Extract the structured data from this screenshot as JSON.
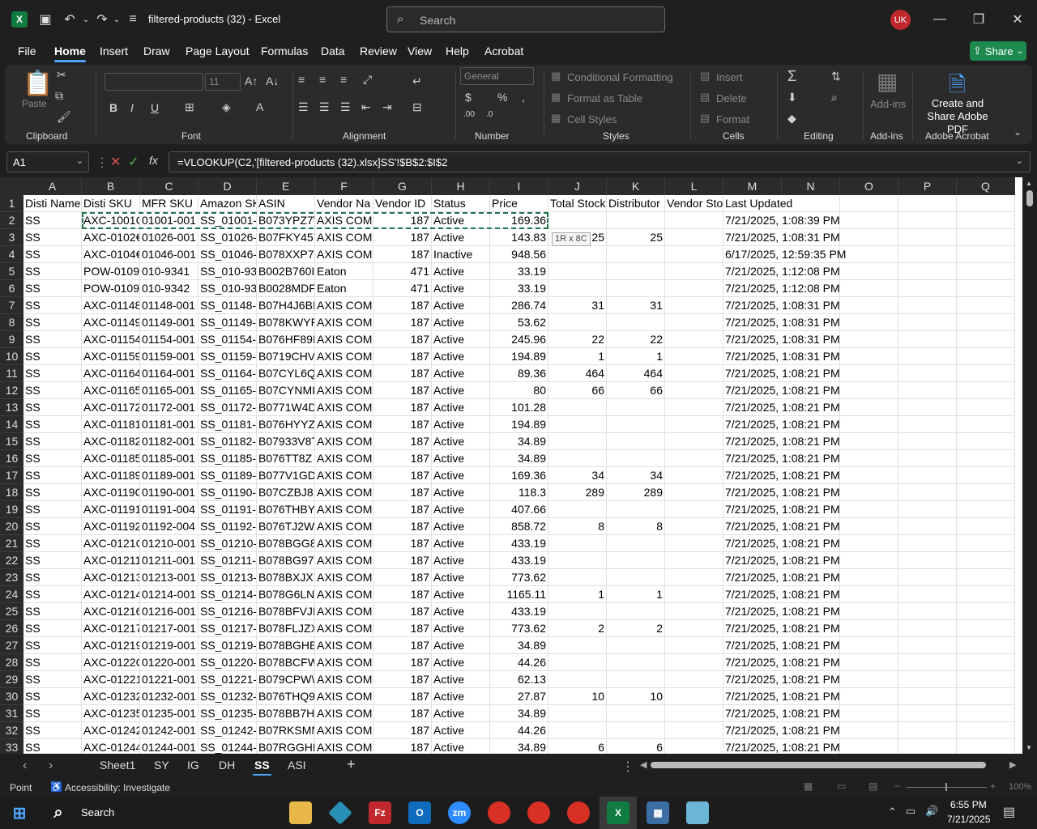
{
  "window": {
    "title": "filtered-products (32)  -  Excel",
    "search_placeholder": "Search",
    "user_initials": "UK",
    "share_label": "Share"
  },
  "ribbon_tabs": [
    "File",
    "Home",
    "Insert",
    "Draw",
    "Page Layout",
    "Formulas",
    "Data",
    "Review",
    "View",
    "Help",
    "Acrobat"
  ],
  "ribbon": {
    "clipboard": {
      "label": "Clipboard",
      "paste": "Paste"
    },
    "font": {
      "label": "Font",
      "size": "11",
      "bold": "B",
      "italic": "I",
      "underline": "U"
    },
    "alignment": {
      "label": "Alignment"
    },
    "number": {
      "label": "Number",
      "format": "General"
    },
    "styles": {
      "label": "Styles",
      "conditional": "Conditional Formatting",
      "format_table": "Format as Table",
      "cell_styles": "Cell Styles"
    },
    "cells": {
      "label": "Cells",
      "insert": "Insert",
      "delete": "Delete",
      "format": "Format"
    },
    "editing": {
      "label": "Editing"
    },
    "addins": {
      "label": "Add-ins",
      "button": "Add-ins"
    },
    "acrobat": {
      "label": "Adobe Acrobat",
      "button": "Create and Share Adobe PDF"
    }
  },
  "formula_bar": {
    "name_box": "A1",
    "formula": "=VLOOKUP(C2,'[filtered-products (32).xlsx]SS'!$B$2:$I$2"
  },
  "columns": [
    "A",
    "B",
    "C",
    "D",
    "E",
    "F",
    "G",
    "H",
    "I",
    "J",
    "K",
    "L",
    "M",
    "N",
    "O",
    "P",
    "Q"
  ],
  "headers": [
    "Disti Name",
    "Disti SKU",
    "MFR SKU",
    "Amazon SK",
    "ASIN",
    "Vendor Na",
    "Vendor ID",
    "Status",
    "Price",
    "Total Stock",
    "Distributor",
    "Vendor Sto",
    "Last Updated"
  ],
  "rows": [
    [
      "SS",
      "AXC-1001C",
      "01001-001",
      "SS_01001-(",
      "B073YPZ7\\",
      "AXIS COMI",
      "187",
      "Active",
      "169.36",
      "",
      "",
      "",
      "7/21/2025, 1:08:39 PM"
    ],
    [
      "SS",
      "AXC-0102€",
      "01026-001",
      "SS_01026-(",
      "B07FKY457",
      "AXIS COMI",
      "187",
      "Active",
      "143.83",
      "25",
      "25",
      "",
      "7/21/2025, 1:08:31 PM"
    ],
    [
      "SS",
      "AXC-0104€",
      "01046-001",
      "SS_01046-(",
      "B078XXP7I",
      "AXIS COMI",
      "187",
      "Inactive",
      "948.56",
      "",
      "",
      "",
      "6/17/2025, 12:59:35 PM"
    ],
    [
      "SS",
      "POW-0109",
      "010-9341",
      "SS_010-93",
      "B002B760I",
      "Eaton",
      "471",
      "Active",
      "33.19",
      "",
      "",
      "",
      "7/21/2025, 1:12:08 PM"
    ],
    [
      "SS",
      "POW-0109",
      "010-9342",
      "SS_010-93",
      "B0028MDF",
      "Eaton",
      "471",
      "Active",
      "33.19",
      "",
      "",
      "",
      "7/21/2025, 1:12:08 PM"
    ],
    [
      "SS",
      "AXC-01148",
      "01148-001",
      "SS_01148-(",
      "B07H4J6BI",
      "AXIS COMI",
      "187",
      "Active",
      "286.74",
      "31",
      "31",
      "",
      "7/21/2025, 1:08:31 PM"
    ],
    [
      "SS",
      "AXC-01149",
      "01149-001",
      "SS_01149-(",
      "B078KWYF",
      "AXIS COMI",
      "187",
      "Active",
      "53.62",
      "",
      "",
      "",
      "7/21/2025, 1:08:31 PM"
    ],
    [
      "SS",
      "AXC-01154",
      "01154-001",
      "SS_01154-(",
      "B076HF89I",
      "AXIS COMI",
      "187",
      "Active",
      "245.96",
      "22",
      "22",
      "",
      "7/21/2025, 1:08:31 PM"
    ],
    [
      "SS",
      "AXC-01159",
      "01159-001",
      "SS_01159-(",
      "B0719CHV",
      "AXIS COMI",
      "187",
      "Active",
      "194.89",
      "1",
      "1",
      "",
      "7/21/2025, 1:08:31 PM"
    ],
    [
      "SS",
      "AXC-01164",
      "01164-001",
      "SS_01164-(",
      "B07CYL6Q",
      "AXIS COMI",
      "187",
      "Active",
      "89.36",
      "464",
      "464",
      "",
      "7/21/2025, 1:08:21 PM"
    ],
    [
      "SS",
      "AXC-01165",
      "01165-001",
      "SS_01165-(",
      "B07CYNMI",
      "AXIS COMI",
      "187",
      "Active",
      "80",
      "66",
      "66",
      "",
      "7/21/2025, 1:08:21 PM"
    ],
    [
      "SS",
      "AXC-01172",
      "01172-001",
      "SS_01172-(",
      "B0771W4D",
      "AXIS COMI",
      "187",
      "Active",
      "101.28",
      "",
      "",
      "",
      "7/21/2025, 1:08:21 PM"
    ],
    [
      "SS",
      "AXC-01181",
      "01181-001",
      "SS_01181-(",
      "B076HYYZ",
      "AXIS COMI",
      "187",
      "Active",
      "194.89",
      "",
      "",
      "",
      "7/21/2025, 1:08:21 PM"
    ],
    [
      "SS",
      "AXC-01182",
      "01182-001",
      "SS_01182-(",
      "B07933V8T",
      "AXIS COMI",
      "187",
      "Active",
      "34.89",
      "",
      "",
      "",
      "7/21/2025, 1:08:21 PM"
    ],
    [
      "SS",
      "AXC-01185",
      "01185-001",
      "SS_01185-(",
      "B076TT8Z",
      "AXIS COMI",
      "187",
      "Active",
      "34.89",
      "",
      "",
      "",
      "7/21/2025, 1:08:21 PM"
    ],
    [
      "SS",
      "AXC-01189",
      "01189-001",
      "SS_01189-(",
      "B077V1GD",
      "AXIS COMI",
      "187",
      "Active",
      "169.36",
      "34",
      "34",
      "",
      "7/21/2025, 1:08:21 PM"
    ],
    [
      "SS",
      "AXC-0119C",
      "01190-001",
      "SS_01190-(",
      "B07CZBJ8",
      "AXIS COMI",
      "187",
      "Active",
      "118.3",
      "289",
      "289",
      "",
      "7/21/2025, 1:08:21 PM"
    ],
    [
      "SS",
      "AXC-01191",
      "01191-004",
      "SS_01191-(",
      "B076THBY",
      "AXIS COMI",
      "187",
      "Active",
      "407.66",
      "",
      "",
      "",
      "7/21/2025, 1:08:21 PM"
    ],
    [
      "SS",
      "AXC-01192",
      "01192-004",
      "SS_01192-(",
      "B076TJ2W",
      "AXIS COMI",
      "187",
      "Active",
      "858.72",
      "8",
      "8",
      "",
      "7/21/2025, 1:08:21 PM"
    ],
    [
      "SS",
      "AXC-0121C",
      "01210-001",
      "SS_01210-(",
      "B078BGG8",
      "AXIS COMI",
      "187",
      "Active",
      "433.19",
      "",
      "",
      "",
      "7/21/2025, 1:08:21 PM"
    ],
    [
      "SS",
      "AXC-01211",
      "01211-001",
      "SS_01211-(",
      "B078BG97",
      "AXIS COMI",
      "187",
      "Active",
      "433.19",
      "",
      "",
      "",
      "7/21/2025, 1:08:21 PM"
    ],
    [
      "SS",
      "AXC-01213",
      "01213-001",
      "SS_01213-(",
      "B078BXJXI",
      "AXIS COMI",
      "187",
      "Active",
      "773.62",
      "",
      "",
      "",
      "7/21/2025, 1:08:21 PM"
    ],
    [
      "SS",
      "AXC-01214",
      "01214-001",
      "SS_01214-(",
      "B078G6LN",
      "AXIS COMI",
      "187",
      "Active",
      "1165.11",
      "1",
      "1",
      "",
      "7/21/2025, 1:08:21 PM"
    ],
    [
      "SS",
      "AXC-01216",
      "01216-001",
      "SS_01216-(",
      "B078BFVJI",
      "AXIS COMI",
      "187",
      "Active",
      "433.19",
      "",
      "",
      "",
      "7/21/2025, 1:08:21 PM"
    ],
    [
      "SS",
      "AXC-01217",
      "01217-001",
      "SS_01217-(",
      "B078FLJZX",
      "AXIS COMI",
      "187",
      "Active",
      "773.62",
      "2",
      "2",
      "",
      "7/21/2025, 1:08:21 PM"
    ],
    [
      "SS",
      "AXC-01219",
      "01219-001",
      "SS_01219-(",
      "B078BGHB",
      "AXIS COMI",
      "187",
      "Active",
      "34.89",
      "",
      "",
      "",
      "7/21/2025, 1:08:21 PM"
    ],
    [
      "SS",
      "AXC-0122C",
      "01220-001",
      "SS_01220-(",
      "B078BCFW",
      "AXIS COMI",
      "187",
      "Active",
      "44.26",
      "",
      "",
      "",
      "7/21/2025, 1:08:21 PM"
    ],
    [
      "SS",
      "AXC-01221",
      "01221-001",
      "SS_01221-(",
      "B079CPW\\",
      "AXIS COMI",
      "187",
      "Active",
      "62.13",
      "",
      "",
      "",
      "7/21/2025, 1:08:21 PM"
    ],
    [
      "SS",
      "AXC-01232",
      "01232-001",
      "SS_01232-(",
      "B076THQ9",
      "AXIS COMI",
      "187",
      "Active",
      "27.87",
      "10",
      "10",
      "",
      "7/21/2025, 1:08:21 PM"
    ],
    [
      "SS",
      "AXC-01235",
      "01235-001",
      "SS_01235-(",
      "B078BB7H",
      "AXIS COMI",
      "187",
      "Active",
      "34.89",
      "",
      "",
      "",
      "7/21/2025, 1:08:21 PM"
    ],
    [
      "SS",
      "AXC-01242",
      "01242-001",
      "SS_01242-(",
      "B07RKSMN",
      "AXIS COMI",
      "187",
      "Active",
      "44.26",
      "",
      "",
      "",
      "7/21/2025, 1:08:21 PM"
    ],
    [
      "SS",
      "AXC-01244",
      "01244-001",
      "SS_01244-(",
      "B07RGGHE",
      "AXIS COMI",
      "187",
      "Active",
      "34.89",
      "6",
      "6",
      "",
      "7/21/2025, 1:08:21 PM"
    ]
  ],
  "selection_tooltip": "1R x 8C",
  "sheet_tabs": [
    "Sheet1",
    "SY",
    "IG",
    "DH",
    "SS",
    "ASI"
  ],
  "active_sheet": "SS",
  "status": {
    "mode": "Point",
    "accessibility": "Accessibility: Investigate",
    "zoom": "100%"
  },
  "taskbar": {
    "search": "Search",
    "time": "6:55 PM",
    "date": "7/21/2025"
  },
  "colors": {
    "excel_green": "#107c41",
    "share_green": "#1e8a50",
    "accent": "#4ea6ff",
    "selection": "#1e7145"
  }
}
